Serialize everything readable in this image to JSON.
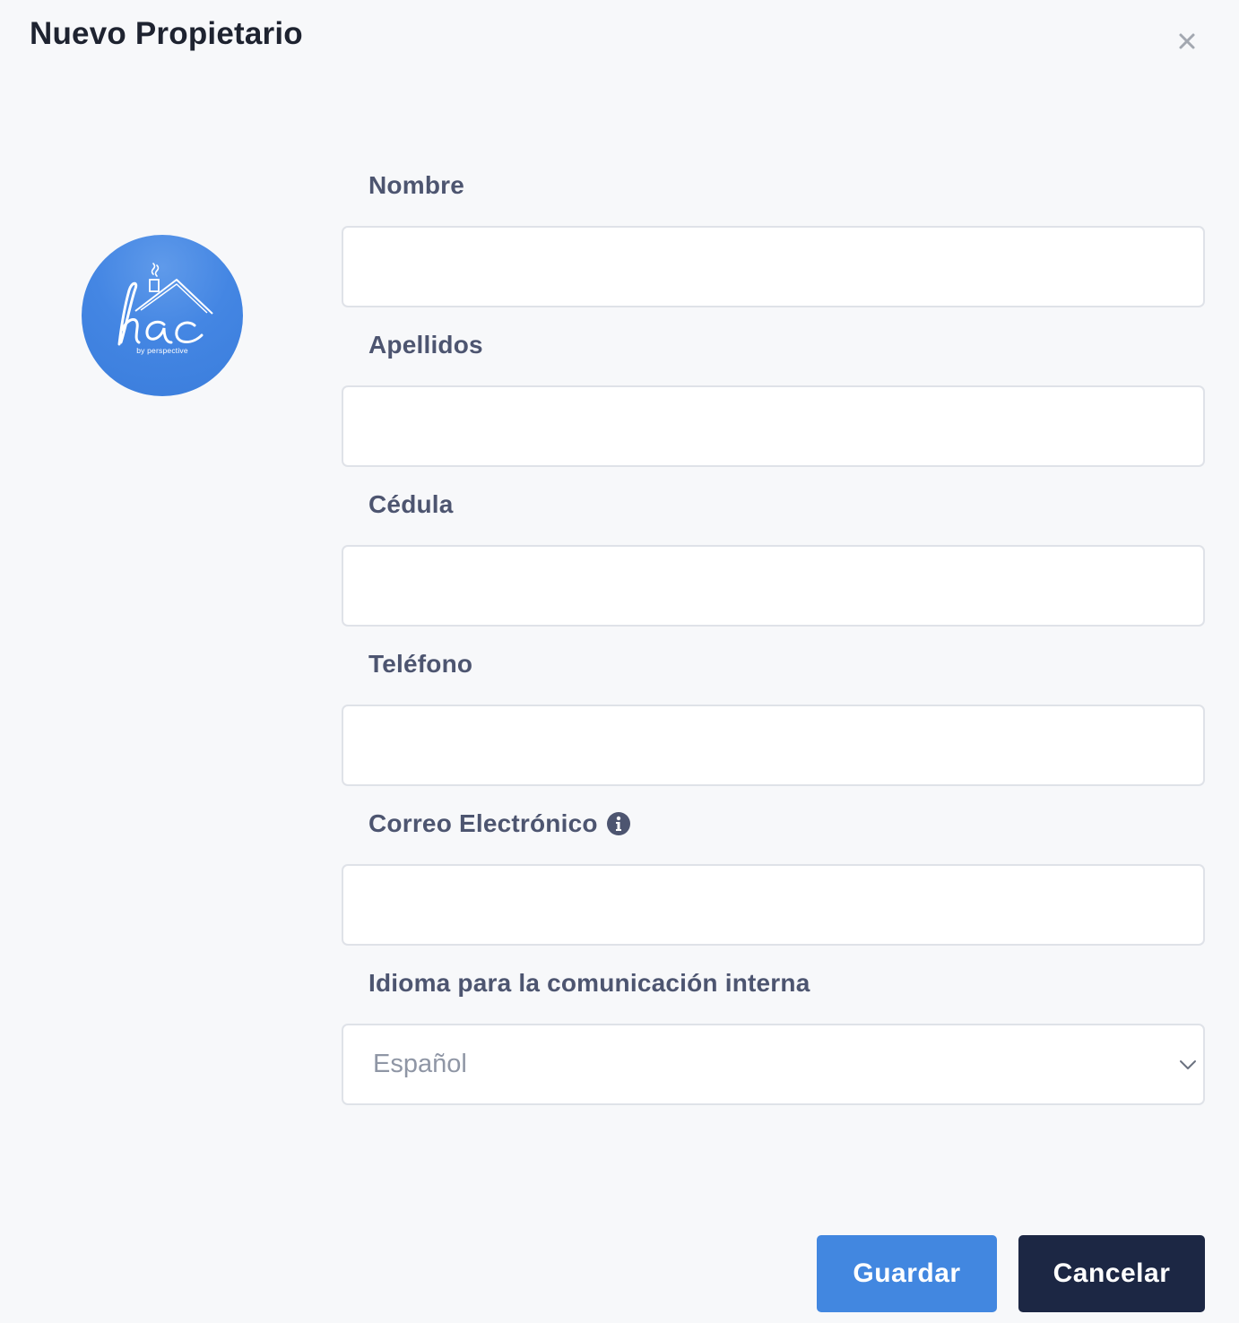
{
  "modal": {
    "title": "Nuevo Propietario",
    "close_icon": "close-icon"
  },
  "logo": {
    "wordmark": "hac",
    "tagline": "by perspective",
    "background_color": "#4487e2"
  },
  "form": {
    "nombre": {
      "label": "Nombre",
      "value": ""
    },
    "apellidos": {
      "label": "Apellidos",
      "value": ""
    },
    "cedula": {
      "label": "Cédula",
      "value": ""
    },
    "telefono": {
      "label": "Teléfono",
      "value": ""
    },
    "correo": {
      "label": "Correo Electrónico",
      "value": "",
      "hint_icon": "info-circle-icon"
    },
    "idioma": {
      "label": "Idioma para la comunicación interna",
      "selected": "Español",
      "dropdown_icon": "chevron-down-icon"
    }
  },
  "actions": {
    "save_label": "Guardar",
    "cancel_label": "Cancelar"
  },
  "colors": {
    "primary": "#4287e0",
    "dark": "#1c2744",
    "label_text": "#4d5570",
    "page_background": "#f7f8fa"
  }
}
